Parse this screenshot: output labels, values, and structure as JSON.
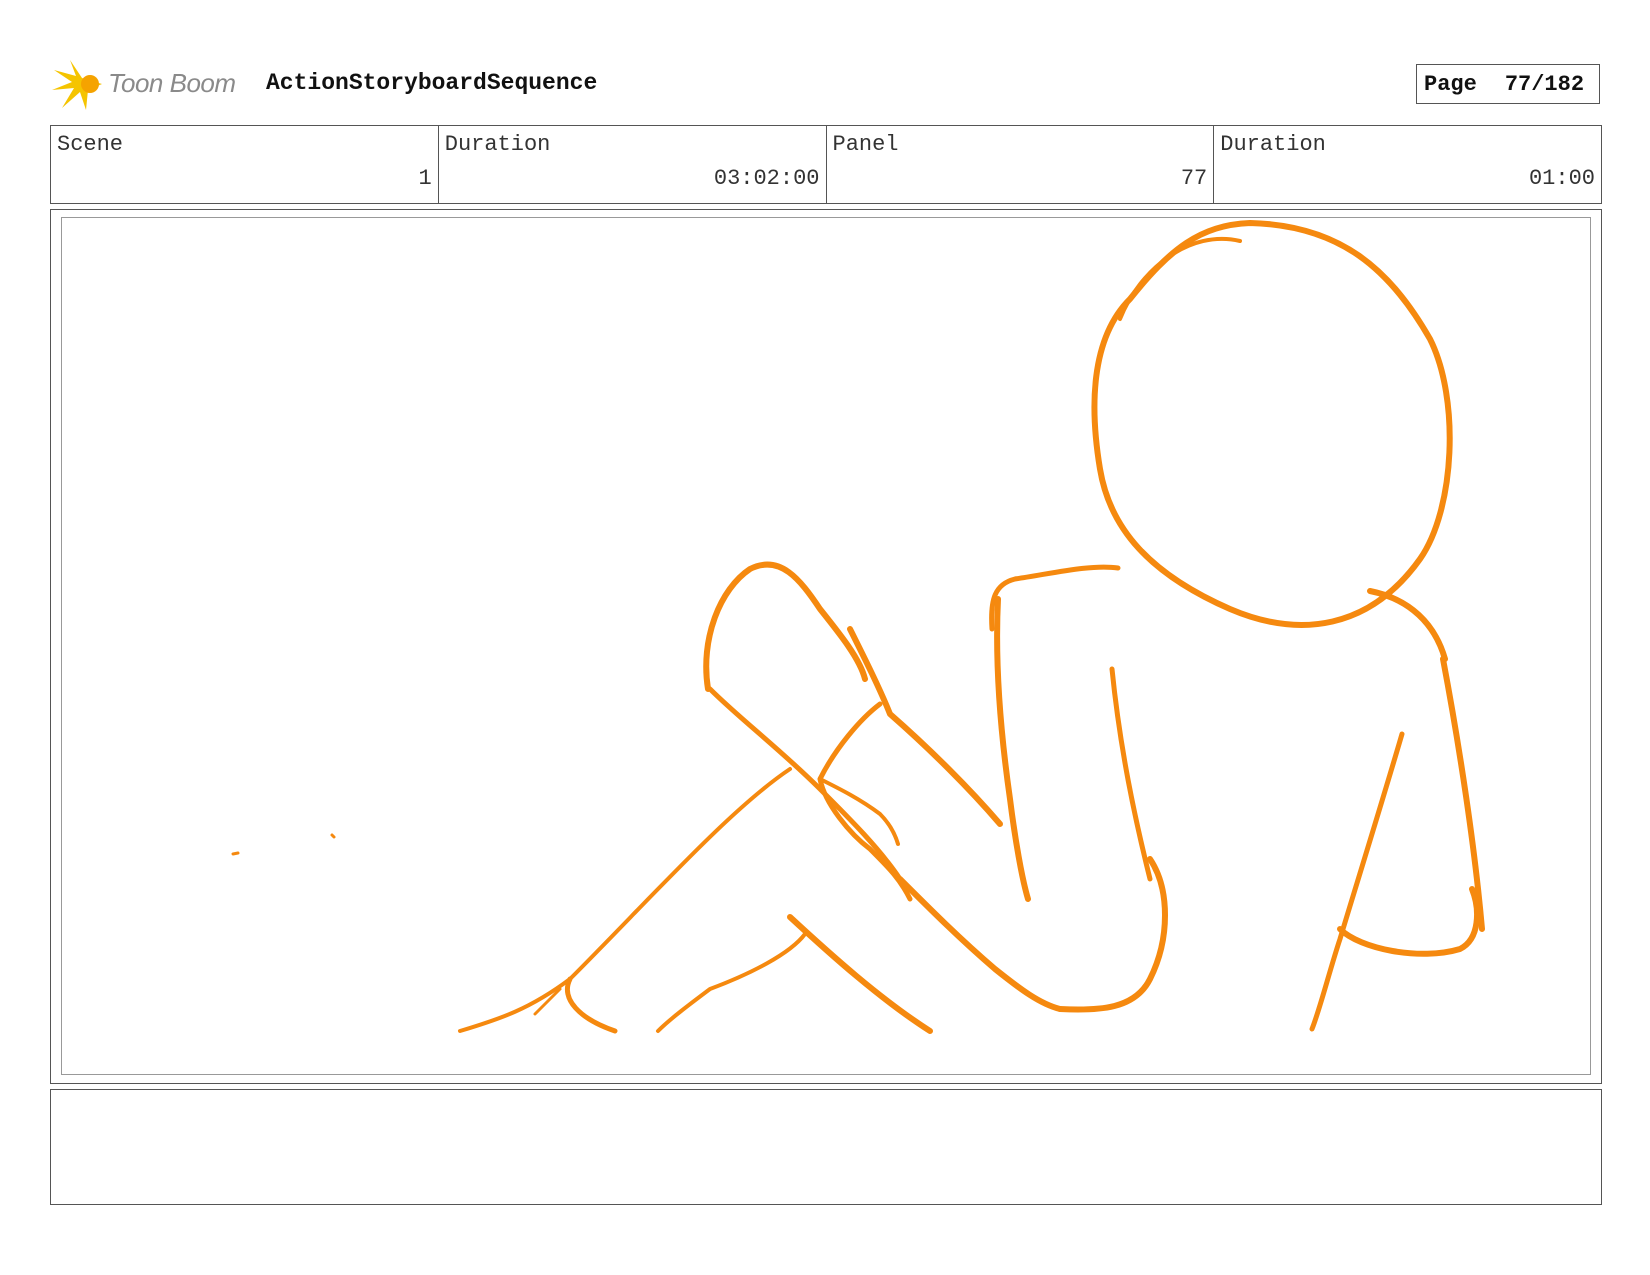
{
  "header": {
    "logo_text": "Toon Boom",
    "title": "ActionStoryboardSequence",
    "page_label": "Page",
    "page_value": "77/182"
  },
  "info": {
    "scene_label": "Scene",
    "scene_value": "1",
    "scene_duration_label": "Duration",
    "scene_duration_value": "03:02:00",
    "panel_label": "Panel",
    "panel_value": "77",
    "panel_duration_label": "Duration",
    "panel_duration_value": "01:00"
  },
  "colors": {
    "sketch": "#f5890f",
    "logo_star": "#f5c400",
    "border": "#555555"
  }
}
